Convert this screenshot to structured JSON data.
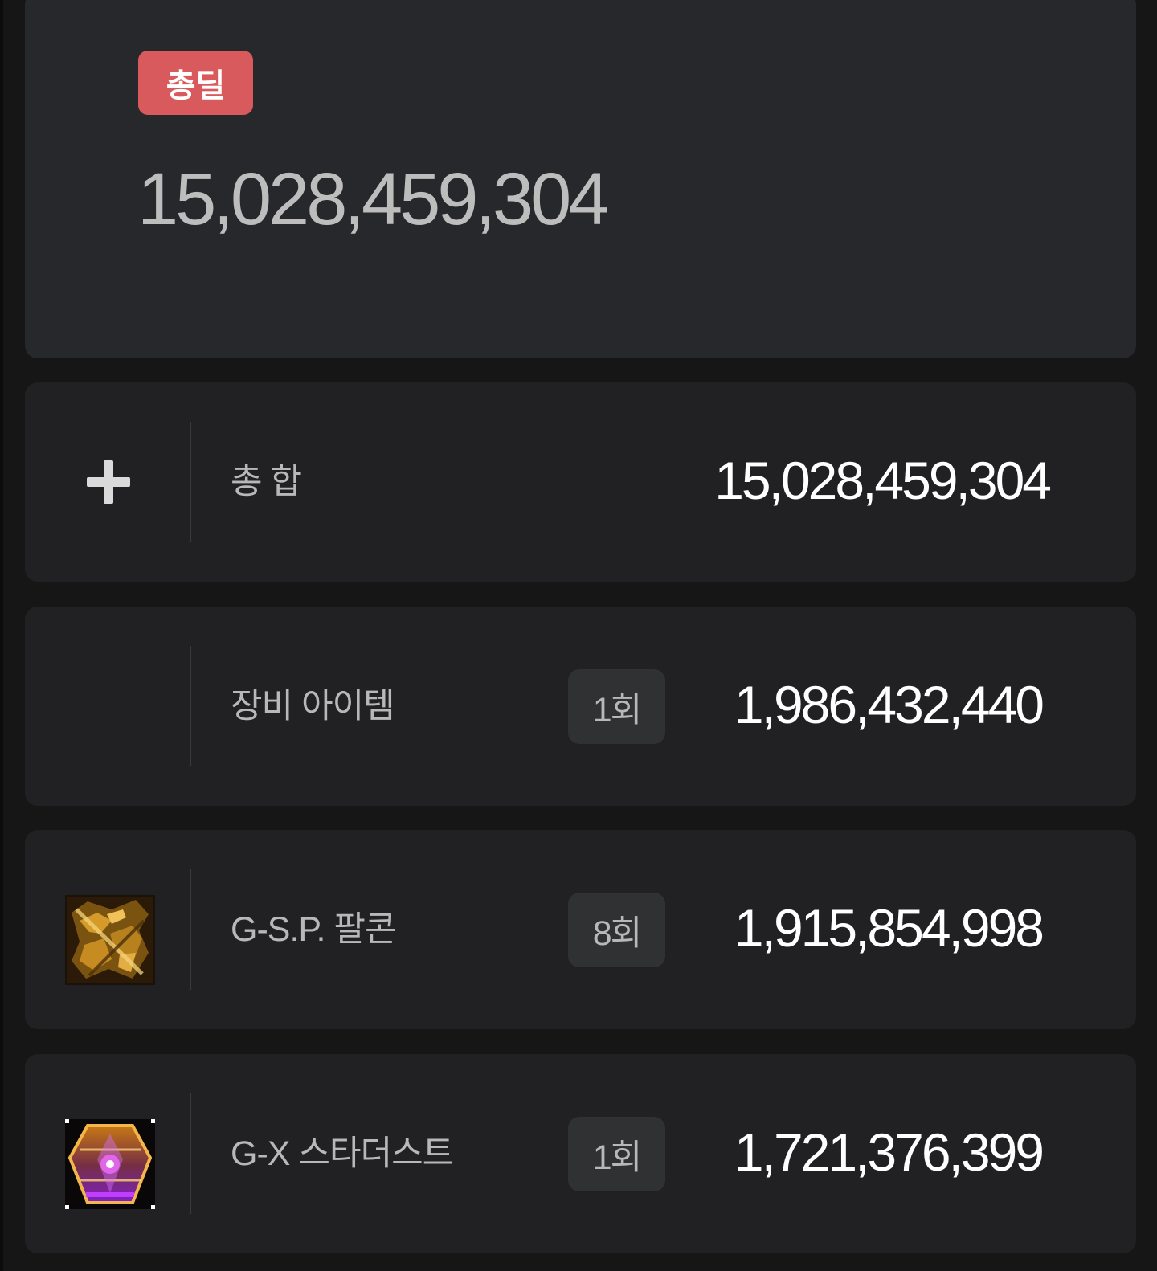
{
  "summary": {
    "badge": "총딜",
    "total_damage": "15,028,459,304",
    "badge_color": "#d95a5d"
  },
  "rows": [
    {
      "icon": "plus-icon",
      "label": "총 합",
      "count": "",
      "value": "15,028,459,304"
    },
    {
      "icon": "",
      "label": "장비 아이템",
      "count": "1회",
      "value": "1,986,432,440"
    },
    {
      "icon": "gsp-falcon-skill-icon",
      "label": "G-S.P. 팔콘",
      "count": "8회",
      "value": "1,915,854,998"
    },
    {
      "icon": "gx-stardust-skill-icon",
      "label": "G-X 스타더스트",
      "count": "1회",
      "value": "1,721,376,399"
    }
  ]
}
